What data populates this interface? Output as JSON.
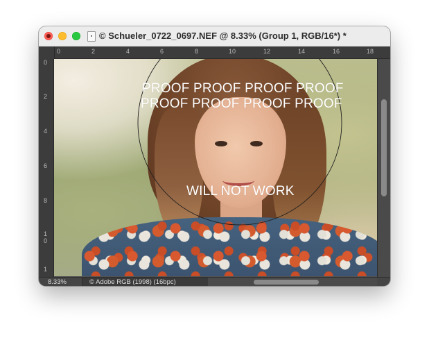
{
  "window": {
    "title": "© Schueler_0722_0697.NEF @ 8.33% (Group 1, RGB/16*) *"
  },
  "rulers": {
    "top": [
      "0",
      "2",
      "4",
      "6",
      "8",
      "10",
      "12",
      "14",
      "16",
      "18"
    ],
    "left": [
      "0",
      "2",
      "4",
      "6",
      "8",
      "1",
      "0",
      "1"
    ]
  },
  "canvas": {
    "proof_line_1": "PROOF PROOF PROOF PROOF",
    "proof_line_2": "PROOF PROOF PROOF PROOF",
    "note": "WILL NOT WORK"
  },
  "status_bar": {
    "zoom": "8.33%",
    "profile": "© Adobe RGB (1998) (16bpc)",
    "chevron": "›"
  },
  "colors": {
    "close": "#fe5f57",
    "minimize": "#febc2e",
    "maximize": "#28c840",
    "workspace": "#535353"
  }
}
